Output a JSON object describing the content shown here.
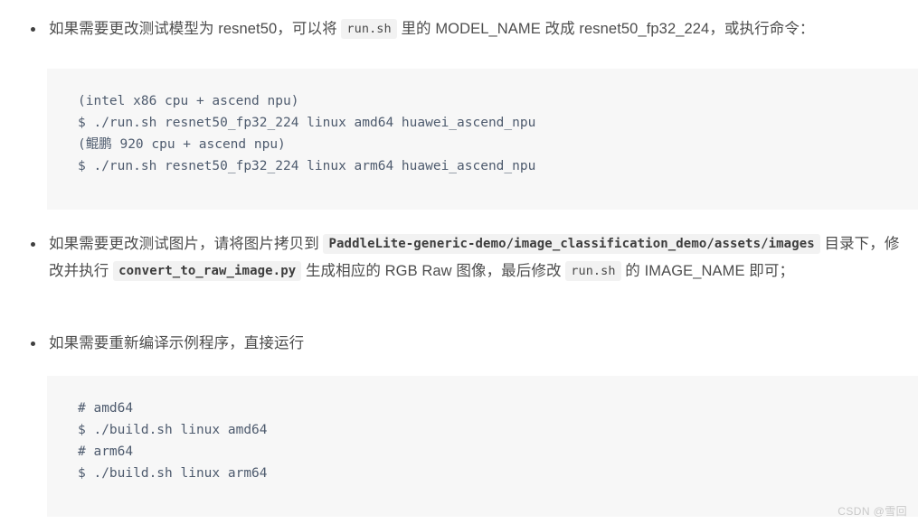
{
  "document": {
    "items": [
      {
        "type": "bullet",
        "id": "bullet-change-model",
        "segments": [
          {
            "kind": "text",
            "value": "如果需要更改测试模型为 resnet50，可以将 "
          },
          {
            "kind": "code",
            "value": "run.sh"
          },
          {
            "kind": "text",
            "value": " 里的 MODEL_NAME 改成 resnet50_fp32_224，或执行命令："
          }
        ]
      },
      {
        "type": "codeblock",
        "id": "codeblock-run-sh",
        "lines": [
          "(intel x86 cpu + ascend npu)",
          "$ ./run.sh resnet50_fp32_224 linux amd64 huawei_ascend_npu",
          "(鲲鹏 920 cpu + ascend npu)",
          "$ ./run.sh resnet50_fp32_224 linux arm64 huawei_ascend_npu"
        ]
      },
      {
        "type": "bullet",
        "id": "bullet-change-image",
        "segments": [
          {
            "kind": "text",
            "value": "如果需要更改测试图片，请将图片拷贝到 "
          },
          {
            "kind": "code-bold",
            "value": "PaddleLite-generic-demo/image_classification_demo/assets/images"
          },
          {
            "kind": "text",
            "value": " 目录下，修改并执行 "
          },
          {
            "kind": "code-bold",
            "value": "convert_to_raw_image.py"
          },
          {
            "kind": "text",
            "value": " 生成相应的 RGB Raw 图像，最后修改 "
          },
          {
            "kind": "code",
            "value": "run.sh"
          },
          {
            "kind": "text",
            "value": " 的 IMAGE_NAME 即可；"
          }
        ]
      },
      {
        "type": "bullet",
        "id": "bullet-rebuild-demo",
        "segments": [
          {
            "kind": "text",
            "value": "如果需要重新编译示例程序，直接运行"
          }
        ]
      },
      {
        "type": "codeblock",
        "id": "codeblock-build-sh",
        "lines": [
          "# amd64",
          "$ ./build.sh linux amd64",
          "# arm64",
          "$ ./build.sh linux arm64"
        ]
      }
    ],
    "watermark": "CSDN @雪回",
    "colors": {
      "page_background": "#ffffff",
      "body_text": "#4d4d4d",
      "code_block_background": "#f7f7f7",
      "code_block_text": "#4e5b6e",
      "inline_code_background": "#f2f2f2",
      "inline_code_text": "#4a4a4a",
      "bullet_marker": "#3f3f3f",
      "watermark_text": "#c9c9c9"
    }
  }
}
